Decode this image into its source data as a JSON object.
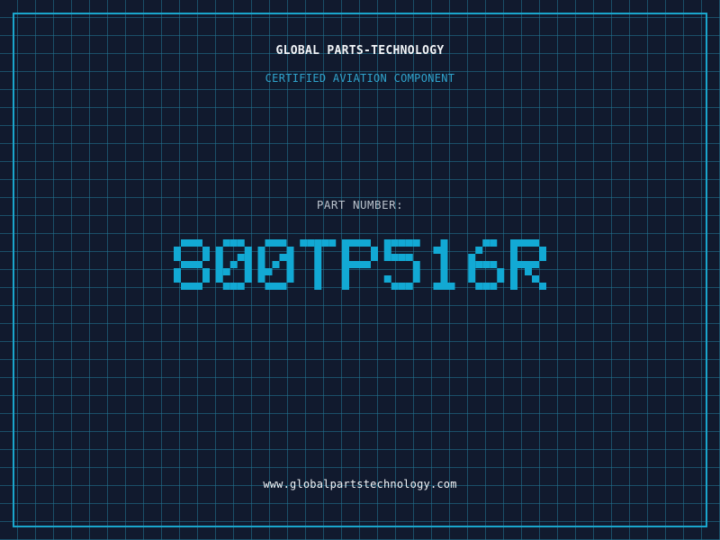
{
  "header": {
    "company": "GLOBAL PARTS-TECHNOLOGY",
    "subtitle": "CERTIFIED AVIATION COMPONENT"
  },
  "part": {
    "label": "PART NUMBER:",
    "number": "800TP516R"
  },
  "footer": {
    "url": "www.globalpartstechnology.com"
  },
  "colors": {
    "background": "#111a2e",
    "grid": "#23788f",
    "frame": "#1aa6cc",
    "accent": "#12a9d4",
    "text": "#f2f5f8",
    "muted": "#b9c2cc"
  }
}
